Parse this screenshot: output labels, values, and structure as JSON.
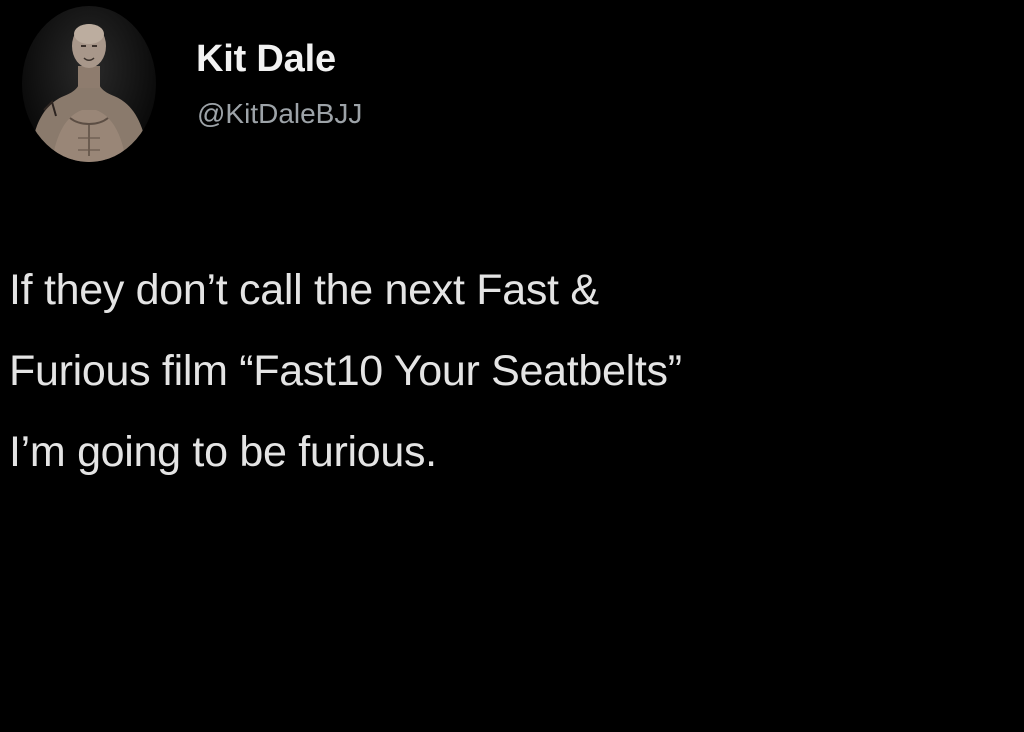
{
  "tweet": {
    "author": {
      "name": "Kit Dale",
      "handle": "@KitDaleBJJ"
    },
    "text_lines": [
      "If they don’t call the next Fast &",
      "Furious film “Fast10 Your Seatbelts”",
      "I’m going to be furious."
    ]
  },
  "colors": {
    "background": "#000000",
    "name": "#f2f2f2",
    "handle": "#9da3a8",
    "text": "#e4e4e4"
  }
}
